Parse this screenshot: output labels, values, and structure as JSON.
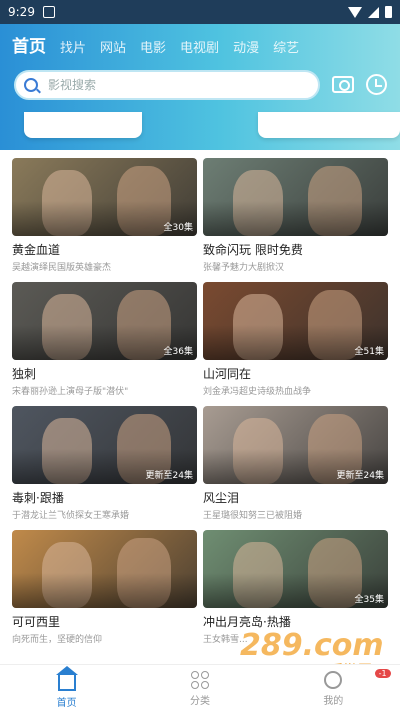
{
  "status": {
    "time": "9:29"
  },
  "tabs": [
    {
      "label": "首页",
      "active": true
    },
    {
      "label": "找片",
      "active": false
    },
    {
      "label": "网站",
      "active": false
    },
    {
      "label": "电影",
      "active": false
    },
    {
      "label": "电视剧",
      "active": false
    },
    {
      "label": "动漫",
      "active": false
    },
    {
      "label": "综艺",
      "active": false
    }
  ],
  "search": {
    "placeholder": "影视搜索",
    "icon": "search-icon"
  },
  "actions": {
    "camera_icon": "camera-icon",
    "history_icon": "history-icon"
  },
  "items": [
    {
      "title": "黄金血道",
      "sub": "吴越演绎民国版英雄豪杰",
      "ep": "全30集",
      "color": "#8a7a5a"
    },
    {
      "title": "致命闪玩 限时免费",
      "sub": "张馨予魅力大剧掀汉",
      "ep": "",
      "color": "#6d7e74"
    },
    {
      "title": "独刺",
      "sub": "宋春丽孙逊上演母子版\"潜伏\"",
      "ep": "全36集",
      "color": "#5b5a55"
    },
    {
      "title": "山河同在",
      "sub": "刘金承冯超史诗级热血战争",
      "ep": "全51集",
      "color": "#7a4a30"
    },
    {
      "title": "毒刺·跟播",
      "sub": "于潜龙让兰飞侦探女王寒承婚",
      "ep": "更新至24集",
      "color": "#4f5660"
    },
    {
      "title": "风尘泪",
      "sub": "王星璐很知努三已被阻婚",
      "ep": "更新至24集",
      "color": "#a89c92"
    },
    {
      "title": "可可西里",
      "sub": "向死而生，坚硬的信仰",
      "ep": "",
      "color": "#c08a4a"
    },
    {
      "title": "冲出月亮岛·热播",
      "sub": "王女韩雪...",
      "ep": "全35集",
      "color": "#6f8e72"
    }
  ],
  "nav": {
    "home": "首页",
    "category": "分类",
    "mine": "我的",
    "badge": "-1"
  },
  "watermark": {
    "main": "289.com",
    "sub": "手游网"
  }
}
